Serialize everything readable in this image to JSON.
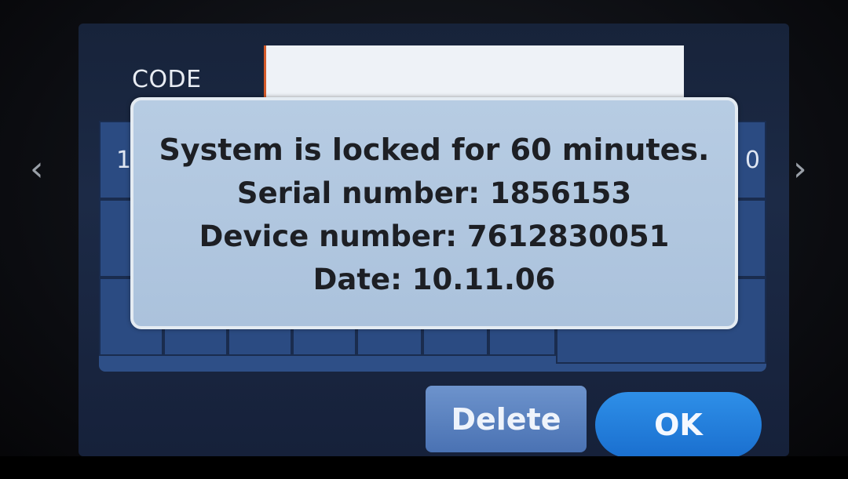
{
  "code_field": {
    "label": "CODE",
    "value": ""
  },
  "keypad": {
    "edge_left_digit": "1",
    "edge_right_digit": "0"
  },
  "buttons": {
    "delete_label": "Delete",
    "ok_label": "OK"
  },
  "navigation": {
    "prev_glyph": "‹",
    "next_glyph": "›"
  },
  "dialog": {
    "lock_message": "System is locked for 60 minutes.",
    "serial_line": "Serial number: 1856153",
    "device_line": "Device number: 7612830051",
    "date_line": "Date: 10.11.06"
  },
  "colors": {
    "dialog_background": "#b7cce3",
    "keypad_background": "#2e4f87",
    "ok_button": "#1a6fcf",
    "delete_button": "#4a72b3"
  }
}
